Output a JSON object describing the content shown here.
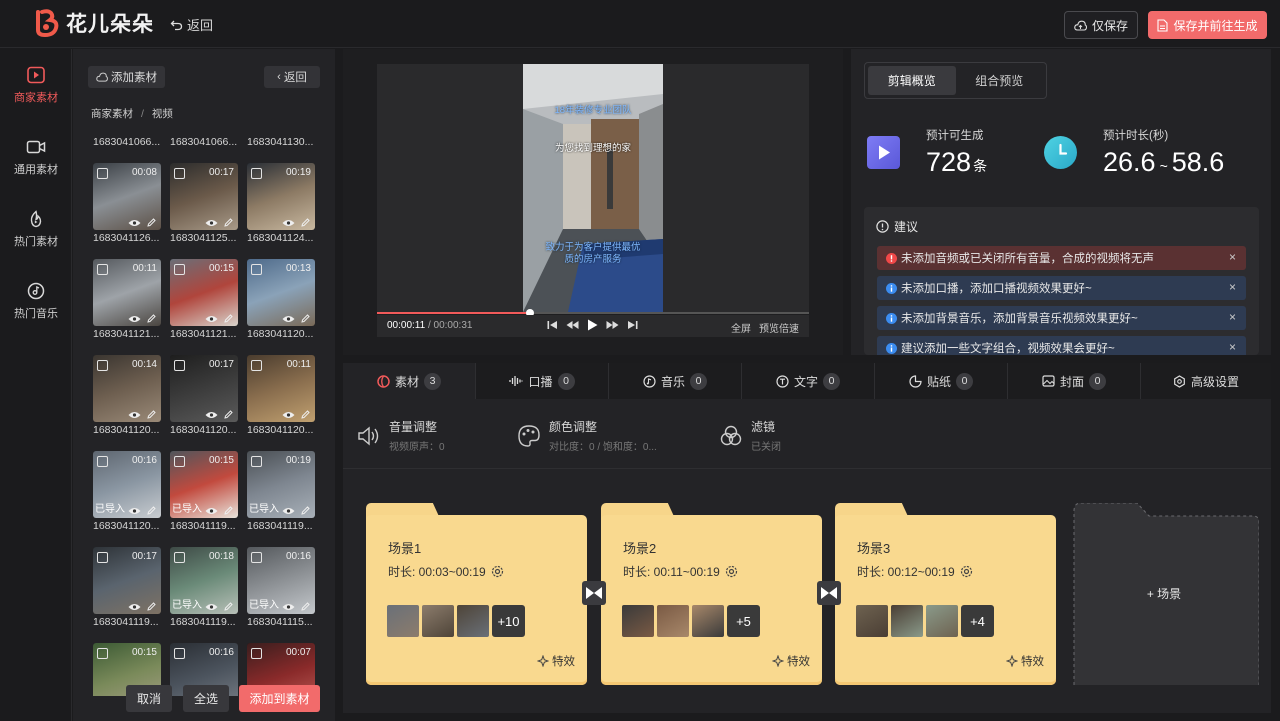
{
  "header": {
    "app_name": "花儿朵朵",
    "back_label": "返回",
    "save_only_label": "仅保存",
    "save_generate_label": "保存并前往生成"
  },
  "nav": [
    {
      "label": "商家素材",
      "icon": "play-square-icon",
      "active": true
    },
    {
      "label": "通用素材",
      "icon": "video-camera-icon",
      "active": false
    },
    {
      "label": "热门素材",
      "icon": "fire-play-icon",
      "active": false
    },
    {
      "label": "热门音乐",
      "icon": "music-disc-icon",
      "active": false
    }
  ],
  "materials": {
    "add_label": "添加素材",
    "back_label": "返回",
    "breadcrumb": [
      "商家素材",
      "视频"
    ],
    "items": [
      {
        "name": "1683041066...",
        "duration": "00:08",
        "imported": false
      },
      {
        "name": "1683041066...",
        "duration": "00:17",
        "imported": false
      },
      {
        "name": "1683041130...",
        "duration": "00:19",
        "imported": false
      },
      {
        "name": "1683041126...",
        "duration": "00:11",
        "imported": false
      },
      {
        "name": "1683041125...",
        "duration": "00:15",
        "imported": false
      },
      {
        "name": "1683041124...",
        "duration": "00:13",
        "imported": false
      },
      {
        "name": "1683041121...",
        "duration": "00:14",
        "imported": false
      },
      {
        "name": "1683041121...",
        "duration": "00:17",
        "imported": false
      },
      {
        "name": "1683041120...",
        "duration": "00:11",
        "imported": false
      },
      {
        "name": "1683041120...",
        "duration": "00:16",
        "imported": true
      },
      {
        "name": "1683041120...",
        "duration": "00:15",
        "imported": true
      },
      {
        "name": "1683041120...",
        "duration": "00:19",
        "imported": true
      },
      {
        "name": "1683041120...",
        "duration": "00:17",
        "imported": false
      },
      {
        "name": "1683041119...",
        "duration": "00:18",
        "imported": true
      },
      {
        "name": "1683041119...",
        "duration": "00:16",
        "imported": true
      },
      {
        "name": "1683041119...",
        "duration": "00:15",
        "imported": false
      },
      {
        "name": "1683041119...",
        "duration": "00:16",
        "imported": false
      },
      {
        "name": "1683041115...",
        "duration": "00:07",
        "imported": false
      }
    ],
    "imported_label": "已导入",
    "cancel_label": "取消",
    "select_all_label": "全选",
    "add_to_label": "添加到素材"
  },
  "player": {
    "captions": [
      "18年装修专业团队",
      "为您找到理想的家",
      "致力于为客户提供最优",
      "质的房产服务"
    ],
    "current_time": "00:00:11",
    "total_time": "/ 00:00:31",
    "progress": 0.355,
    "fullscreen_label": "全屏",
    "speed_label": "预览倍速"
  },
  "overview": {
    "tabs": [
      "剪辑概览",
      "组合预览"
    ],
    "count_label": "预计可生成",
    "count_value": "728",
    "count_unit": "条",
    "duration_label": "预计时长(秒)",
    "duration_min": "26.6",
    "duration_sep": "~",
    "duration_max": "58.6",
    "suggest_title": "建议",
    "suggestions": [
      {
        "type": "error",
        "text": "未添加音频或已关闭所有音量，合成的视频将无声"
      },
      {
        "type": "info",
        "text": "未添加口播，添加口播视频效果更好~"
      },
      {
        "type": "info",
        "text": "未添加背景音乐，添加背景音乐视频效果更好~"
      },
      {
        "type": "info",
        "text": "建议添加一些文字组合，视频效果会更好~"
      }
    ]
  },
  "editor": {
    "tabs": [
      {
        "label": "素材",
        "count": "3"
      },
      {
        "label": "口播",
        "count": "0"
      },
      {
        "label": "音乐",
        "count": "0"
      },
      {
        "label": "文字",
        "count": "0"
      },
      {
        "label": "贴纸",
        "count": "0"
      },
      {
        "label": "封面",
        "count": "0"
      },
      {
        "label": "高级设置",
        "count": ""
      }
    ],
    "adjust": [
      {
        "title": "音量调整",
        "sub": "视频原声：0"
      },
      {
        "title": "颜色调整",
        "sub": "对比度：0 / 饱和度：0..."
      },
      {
        "title": "滤镜",
        "sub": "已关闭"
      }
    ],
    "scenes": [
      {
        "name": "场景1",
        "duration": "时长: 00:03~00:19",
        "more": "+10"
      },
      {
        "name": "场景2",
        "duration": "时长: 00:11~00:19",
        "more": "+5"
      },
      {
        "name": "场景3",
        "duration": "时长: 00:12~00:19",
        "more": "+4"
      }
    ],
    "effect_label": "特效",
    "add_scene_label": "+ 场景"
  },
  "colors": {
    "accent": "#f26b6b",
    "scene_folder": "#f9d98f",
    "error_row": "#5a3132",
    "info_row": "#2e3b52"
  }
}
